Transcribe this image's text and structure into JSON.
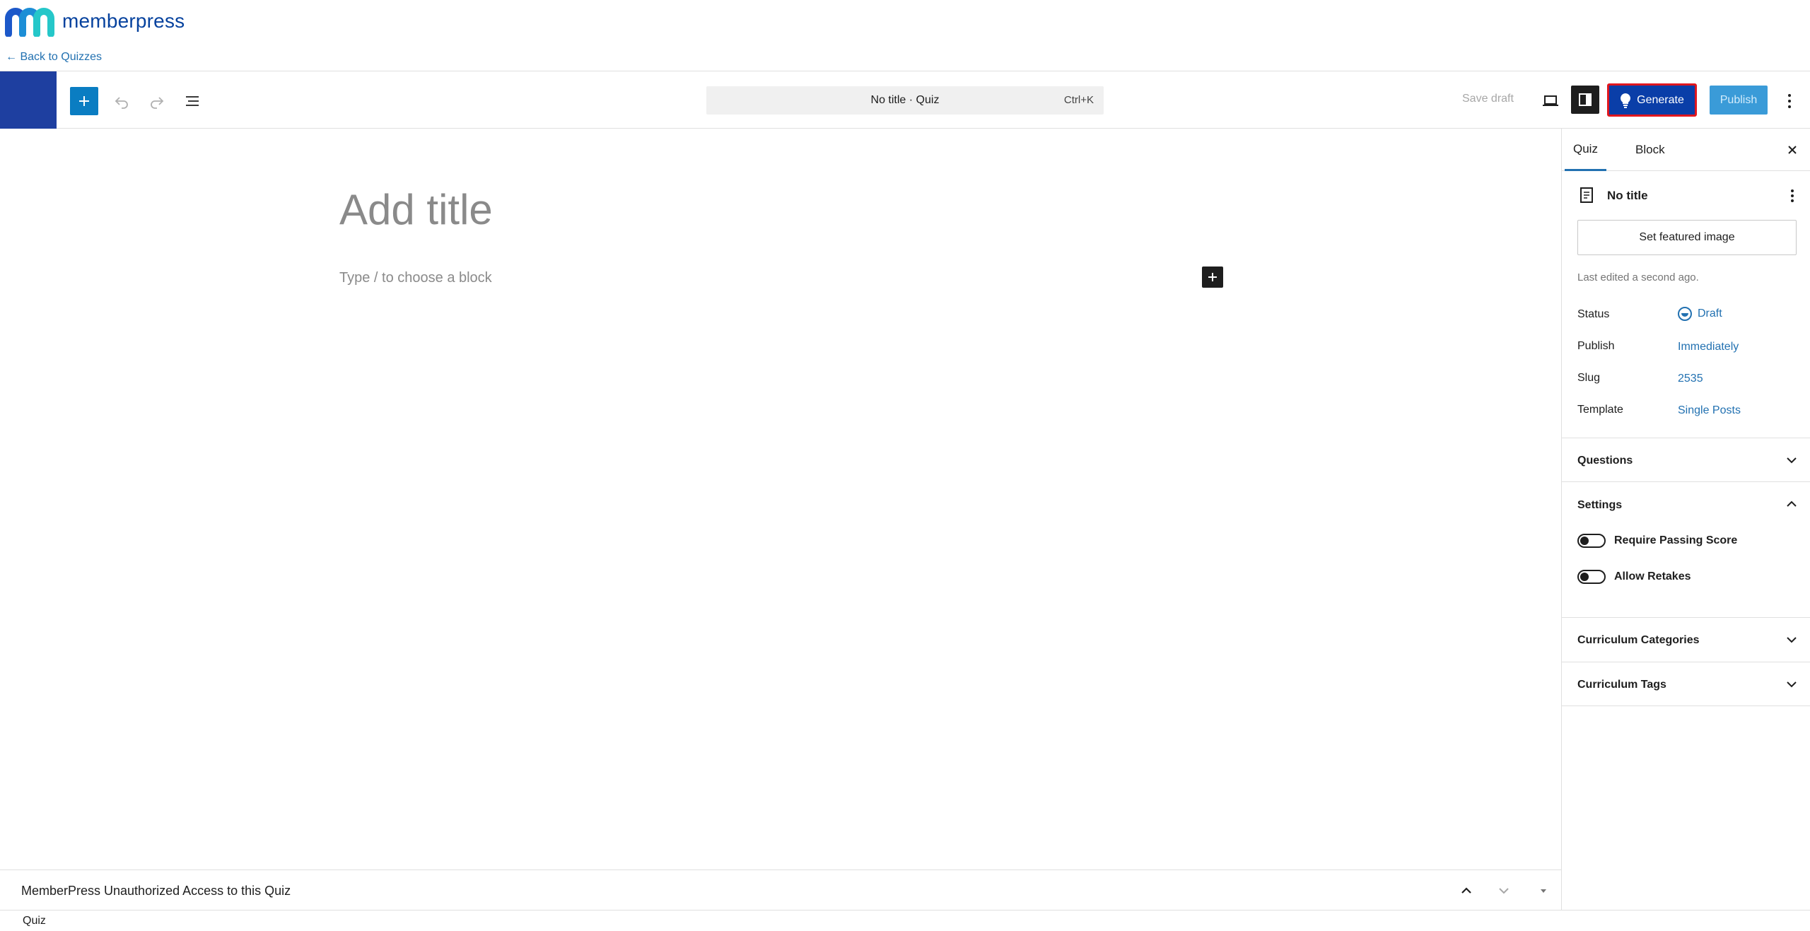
{
  "brand": {
    "name": "memberpress",
    "back_link": "← Back to Quizzes"
  },
  "header": {
    "command_bar_title": "No title · Quiz",
    "command_bar_shortcut": "Ctrl+K",
    "save_draft_label": "Save draft",
    "generate_label": "Generate",
    "publish_label": "Publish"
  },
  "canvas": {
    "title_placeholder": "Add title",
    "block_placeholder": "Type / to choose a block"
  },
  "sidebar": {
    "tabs": [
      {
        "label": "Quiz",
        "active": true
      },
      {
        "label": "Block",
        "active": false
      }
    ],
    "document_title": "No title",
    "featured_image_label": "Set featured image",
    "last_edited": "Last edited a second ago.",
    "meta": [
      {
        "label": "Status",
        "value": "Draft"
      },
      {
        "label": "Publish",
        "value": "Immediately"
      },
      {
        "label": "Slug",
        "value": "2535"
      },
      {
        "label": "Template",
        "value": "Single Posts"
      }
    ],
    "panels": {
      "questions": "Questions",
      "settings": "Settings",
      "curriculum_categories": "Curriculum Categories",
      "curriculum_tags": "Curriculum Tags"
    },
    "settings_toggles": [
      {
        "label": "Require Passing Score",
        "enabled": false
      },
      {
        "label": "Allow Retakes",
        "enabled": false
      }
    ]
  },
  "metabox": {
    "title": "MemberPress Unauthorized Access to this Quiz"
  },
  "footer": {
    "breadcrumb": "Quiz"
  },
  "colors": {
    "accent": "#2271b1",
    "brand_blue": "#06429e",
    "site_icon": "#1e3fa0",
    "generate_bg": "#0a3ea8",
    "generate_outline": "#e0161e",
    "publish_bg": "#3a9bd8"
  },
  "icons": {
    "inserter": "plus-icon",
    "undo": "undo-icon",
    "redo": "redo-icon",
    "list_view": "list-view-icon",
    "preview": "desktop-preview-icon",
    "settings": "sidebar-settings-icon",
    "generate": "lightbulb-icon",
    "options": "vertical-ellipsis-icon",
    "close": "close-icon"
  }
}
